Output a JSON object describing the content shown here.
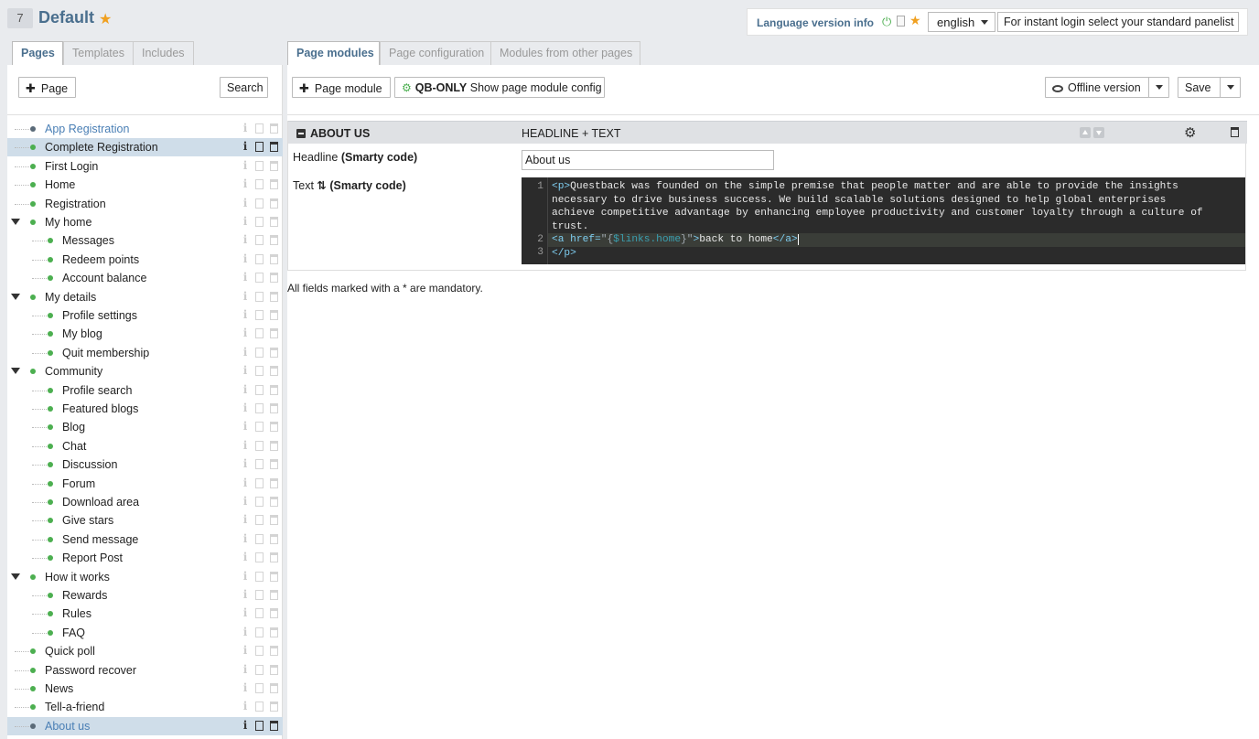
{
  "header": {
    "page_number": "7",
    "page_title": "Default",
    "language_info_label": "Language version info",
    "language_selected": "english",
    "instant_login_text": "For instant login select your standard panelist"
  },
  "left_tabs": [
    {
      "label": "Pages",
      "active": true
    },
    {
      "label": "Templates",
      "active": false
    },
    {
      "label": "Includes",
      "active": false
    }
  ],
  "right_tabs": [
    {
      "label": "Page modules",
      "active": true
    },
    {
      "label": "Page configuration",
      "active": false
    },
    {
      "label": "Modules from other pages",
      "active": false
    }
  ],
  "left_toolbar": {
    "add_page_label": "Page",
    "search_label": "Search"
  },
  "tree": [
    {
      "label": "App Registration",
      "level": 0,
      "bullet": "grey",
      "link": true
    },
    {
      "label": "Complete Registration",
      "level": 0,
      "bullet": "green",
      "selected": true
    },
    {
      "label": "First Login",
      "level": 0,
      "bullet": "green"
    },
    {
      "label": "Home",
      "level": 0,
      "bullet": "green"
    },
    {
      "label": "Registration",
      "level": 0,
      "bullet": "green"
    },
    {
      "label": "My home",
      "level": 0,
      "bullet": "green",
      "expanded": true
    },
    {
      "label": "Messages",
      "level": 1,
      "bullet": "green"
    },
    {
      "label": "Redeem points",
      "level": 1,
      "bullet": "green"
    },
    {
      "label": "Account balance",
      "level": 1,
      "bullet": "green"
    },
    {
      "label": "My details",
      "level": 0,
      "bullet": "green",
      "expanded": true
    },
    {
      "label": "Profile settings",
      "level": 1,
      "bullet": "green"
    },
    {
      "label": "My blog",
      "level": 1,
      "bullet": "green"
    },
    {
      "label": "Quit membership",
      "level": 1,
      "bullet": "green"
    },
    {
      "label": "Community",
      "level": 0,
      "bullet": "green",
      "expanded": true
    },
    {
      "label": "Profile search",
      "level": 1,
      "bullet": "green"
    },
    {
      "label": "Featured blogs",
      "level": 1,
      "bullet": "green"
    },
    {
      "label": "Blog",
      "level": 1,
      "bullet": "green"
    },
    {
      "label": "Chat",
      "level": 1,
      "bullet": "green"
    },
    {
      "label": "Discussion",
      "level": 1,
      "bullet": "green"
    },
    {
      "label": "Forum",
      "level": 1,
      "bullet": "green"
    },
    {
      "label": "Download area",
      "level": 1,
      "bullet": "green"
    },
    {
      "label": "Give stars",
      "level": 1,
      "bullet": "green"
    },
    {
      "label": "Send message",
      "level": 1,
      "bullet": "green"
    },
    {
      "label": "Report Post",
      "level": 1,
      "bullet": "green"
    },
    {
      "label": "How it works",
      "level": 0,
      "bullet": "green",
      "expanded": true
    },
    {
      "label": "Rewards",
      "level": 1,
      "bullet": "green"
    },
    {
      "label": "Rules",
      "level": 1,
      "bullet": "green"
    },
    {
      "label": "FAQ",
      "level": 1,
      "bullet": "green"
    },
    {
      "label": "Quick poll",
      "level": 0,
      "bullet": "green"
    },
    {
      "label": "Password recover",
      "level": 0,
      "bullet": "green"
    },
    {
      "label": "News",
      "level": 0,
      "bullet": "green"
    },
    {
      "label": "Tell-a-friend",
      "level": 0,
      "bullet": "green"
    },
    {
      "label": "About us",
      "level": 0,
      "bullet": "grey",
      "link": true,
      "highlighted": true
    }
  ],
  "right_toolbar": {
    "add_module_label": "Page module",
    "qb_only_label": "QB-ONLY",
    "show_config_label": "Show page module config",
    "offline_label": "Offline version",
    "save_label": "Save"
  },
  "module": {
    "name": "ABOUT US",
    "type": "HEADLINE + TEXT",
    "headline_label": "Headline",
    "headline_smarty": "(Smarty code)",
    "headline_value": "About us",
    "text_label": "Text",
    "text_smarty": "(Smarty code)",
    "code": {
      "line1_a": "Questback was founded on the simple premise that people matter and are able to provide the insights",
      "line1_b": "necessary to drive business success. We build scalable solutions designed to help global enterprises",
      "line1_c": "achieve competitive advantage by enhancing employee productivity and customer loyalty through a culture of",
      "line1_d": "trust.",
      "line2_text": "back to home",
      "line2_var": "$links",
      "line2_prop": ".home"
    }
  },
  "mandatory_note": "All fields marked with a * are mandatory.",
  "colors": {
    "accent": "#4a6f8e",
    "status_green": "#4caf50",
    "star": "#f0a020",
    "selected_row": "#cfdde9"
  }
}
